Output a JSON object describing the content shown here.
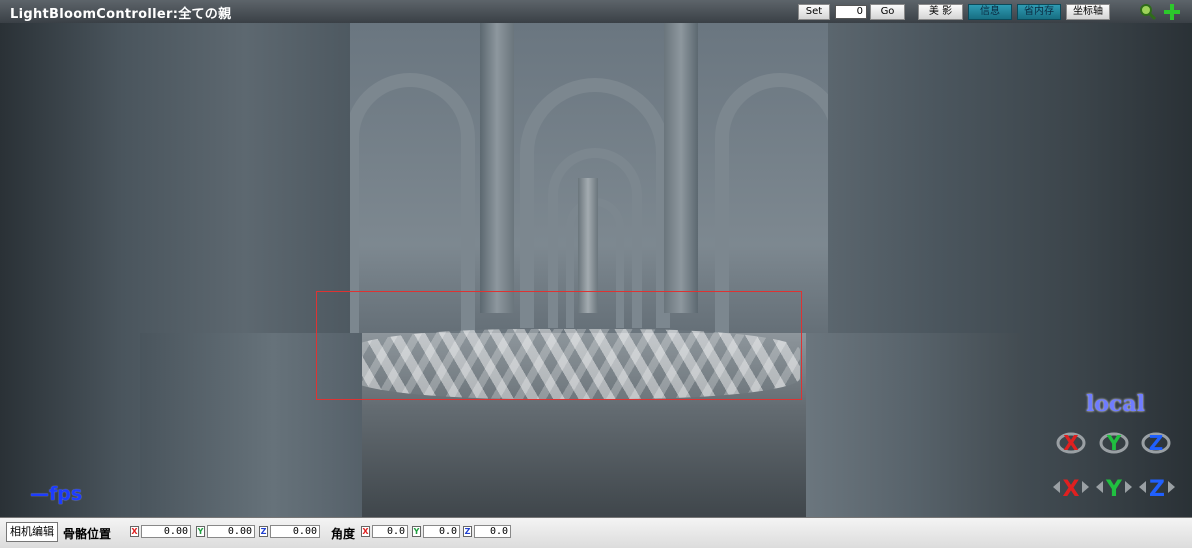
{
  "title": "LightBloomController:全ての親",
  "toolbar": {
    "set_label": "Set",
    "frame_value": "0",
    "go_label": "Go",
    "beauty_label": "美 影",
    "info_label": "信息",
    "save_label": "省内存",
    "axis_label": "坐标轴",
    "icons": [
      "magnifier-icon",
      "plus-icon"
    ]
  },
  "viewport": {
    "coord_mode": "local",
    "fps": "—fps",
    "rotate_axes": [
      "X",
      "Y",
      "Z"
    ],
    "move_axes": [
      "X",
      "Y",
      "Z"
    ],
    "colors": {
      "x": "#e02020",
      "y": "#20c040",
      "z": "#2060ff",
      "selection": "#d33333"
    }
  },
  "bottom": {
    "edit_button": "相机编辑",
    "bone_position_label": "骨骼位置",
    "angle_label": "角度",
    "position": {
      "x": "0.00",
      "y": "0.00",
      "z": "0.00"
    },
    "angle": {
      "x": "0.0",
      "y": "0.0",
      "z": "0.0"
    },
    "tags": {
      "x": "X",
      "y": "Y",
      "z": "Z"
    }
  }
}
